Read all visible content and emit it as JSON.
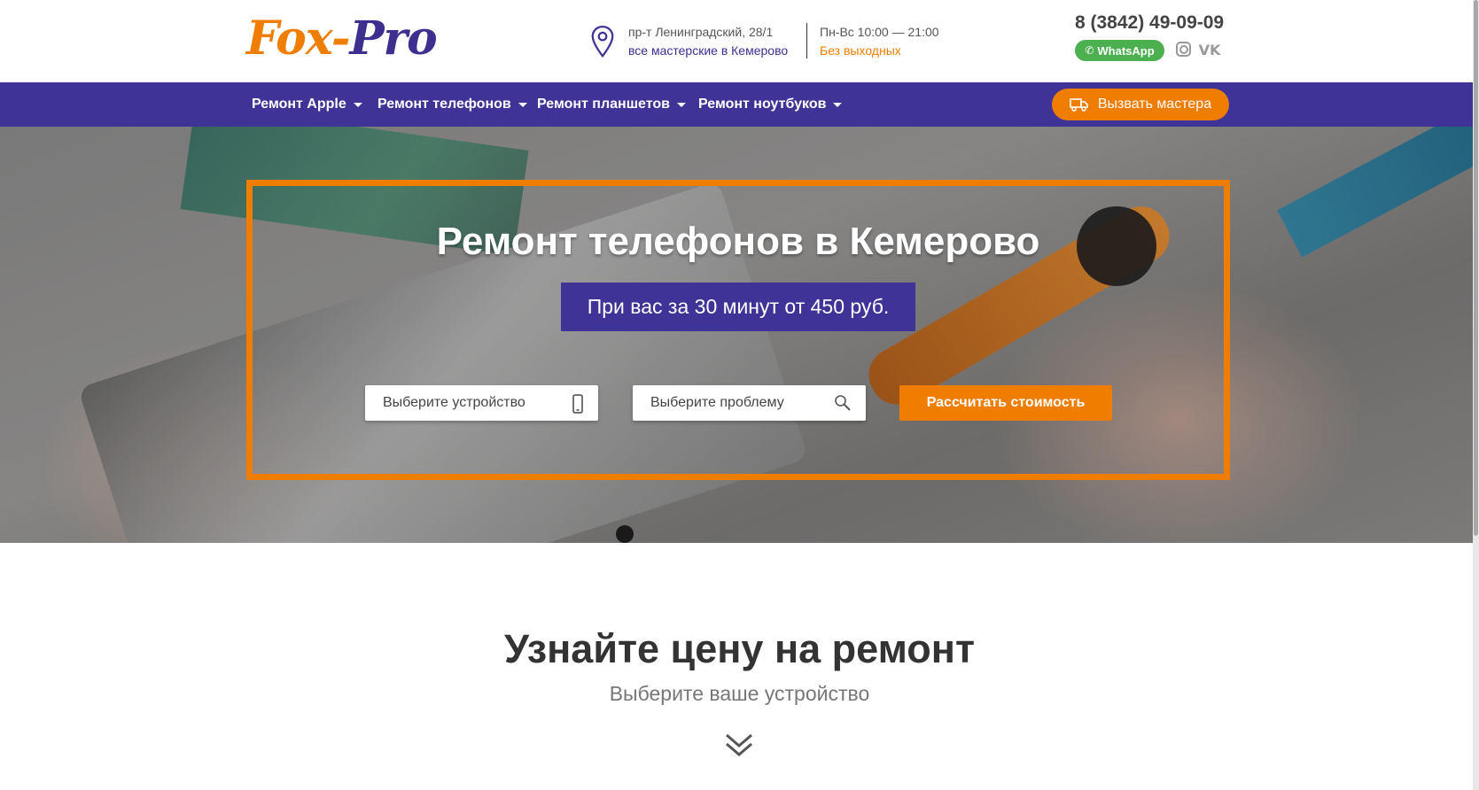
{
  "header": {
    "logo": {
      "part1": "Fox",
      "dash": "-",
      "part2": "Pro"
    },
    "address": {
      "line1": "пр-т Ленинградский, 28/1",
      "line2": "все мастерские в Кемерово",
      "icon": "map-pin-icon"
    },
    "hours": {
      "line1": "Пн-Вс 10:00 — 21:00",
      "line2": "Без выходных"
    },
    "phone": "8 (3842) 49-09-09",
    "whatsapp_label": "WhatsApp",
    "social": [
      "instagram-icon",
      "vk-icon"
    ],
    "vk_label": "VK"
  },
  "nav": {
    "items": [
      {
        "label": "Ремонт Apple"
      },
      {
        "label": "Ремонт телефонов"
      },
      {
        "label": "Ремонт планшетов"
      },
      {
        "label": "Ремонт ноутбуков"
      }
    ],
    "call_button": "Вызвать мастера"
  },
  "hero": {
    "title": "Ремонт телефонов в Кемерово",
    "subtitle": "При вас за 30 минут от 450 руб.",
    "device_select": "Выберите устройство",
    "problem_select": "Выберите проблему",
    "calc_button": "Рассчитать стоимость"
  },
  "pricing": {
    "title": "Узнайте цену на ремонт",
    "subtitle": "Выберите ваше устройство"
  },
  "colors": {
    "brand_orange": "#ef7d00",
    "brand_purple": "#3f3397",
    "whatsapp_green": "#4caf50"
  }
}
